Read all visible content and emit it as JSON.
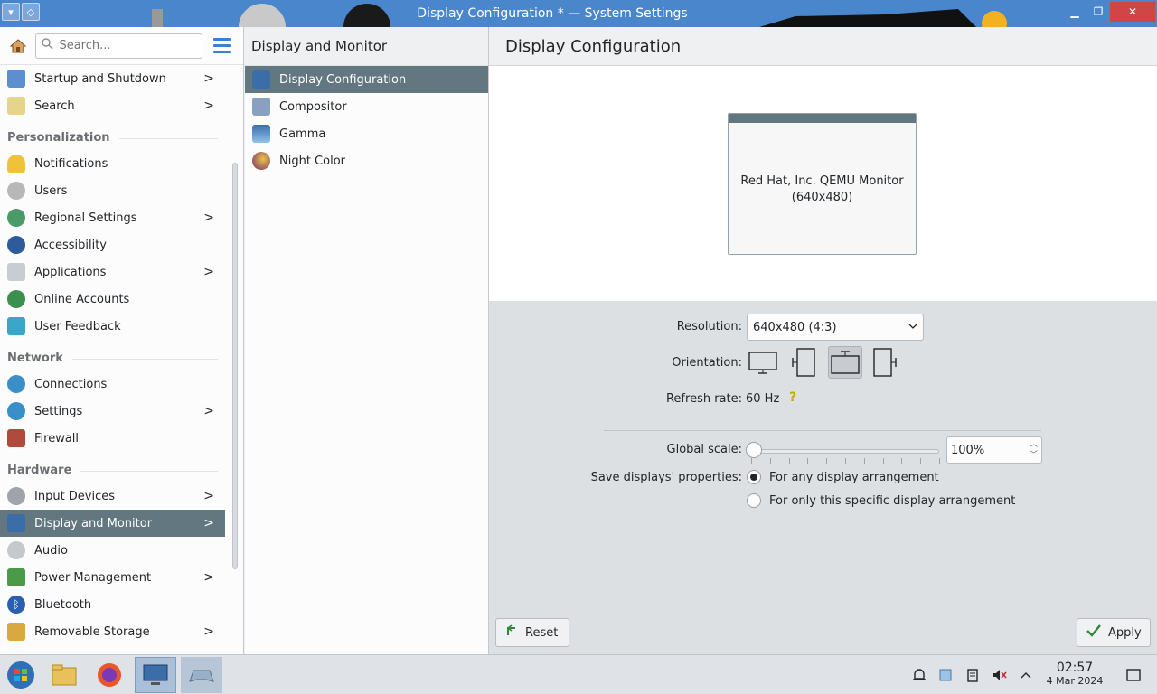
{
  "window": {
    "title": "Display Configuration * — System Settings"
  },
  "search": {
    "placeholder": "Search..."
  },
  "sidebar": {
    "items_top": [
      {
        "label": "Startup and Shutdown",
        "chevron": true
      },
      {
        "label": "Search",
        "chevron": true
      }
    ],
    "sections": [
      {
        "title": "Personalization",
        "items": [
          {
            "label": "Notifications",
            "chevron": false
          },
          {
            "label": "Users",
            "chevron": false
          },
          {
            "label": "Regional Settings",
            "chevron": true
          },
          {
            "label": "Accessibility",
            "chevron": false
          },
          {
            "label": "Applications",
            "chevron": true
          },
          {
            "label": "Online Accounts",
            "chevron": false
          },
          {
            "label": "User Feedback",
            "chevron": false
          }
        ]
      },
      {
        "title": "Network",
        "items": [
          {
            "label": "Connections",
            "chevron": false
          },
          {
            "label": "Settings",
            "chevron": true
          },
          {
            "label": "Firewall",
            "chevron": false
          }
        ]
      },
      {
        "title": "Hardware",
        "items": [
          {
            "label": "Input Devices",
            "chevron": true
          },
          {
            "label": "Display and Monitor",
            "chevron": true,
            "selected": true
          },
          {
            "label": "Audio",
            "chevron": false
          },
          {
            "label": "Power Management",
            "chevron": true
          },
          {
            "label": "Bluetooth",
            "chevron": false
          },
          {
            "label": "Removable Storage",
            "chevron": true
          }
        ]
      }
    ]
  },
  "middle": {
    "title": "Display and Monitor",
    "items": [
      {
        "label": "Display Configuration",
        "selected": true
      },
      {
        "label": "Compositor"
      },
      {
        "label": "Gamma"
      },
      {
        "label": "Night Color"
      }
    ]
  },
  "main": {
    "title": "Display Configuration",
    "monitor": {
      "name": "Red Hat, Inc. QEMU Monitor",
      "resolution": "(640x480)"
    },
    "resolution_label": "Resolution:",
    "resolution_value": "640x480 (4:3)",
    "orientation_label": "Orientation:",
    "refresh_label": "Refresh rate:",
    "refresh_value": "60 Hz",
    "scale_label": "Global scale:",
    "scale_value": "100%",
    "scale_fraction": 0.0,
    "save_label": "Save displays' properties:",
    "save_options": [
      {
        "label": "For any display arrangement",
        "checked": true
      },
      {
        "label": "For only this specific display arrangement",
        "checked": false
      }
    ],
    "reset_label": "Reset",
    "apply_label": "Apply"
  },
  "taskbar": {
    "time": "02:57",
    "date": "4 Mar 2024"
  },
  "colors": {
    "selection": "#637780",
    "accent": "#3a7fd5"
  }
}
